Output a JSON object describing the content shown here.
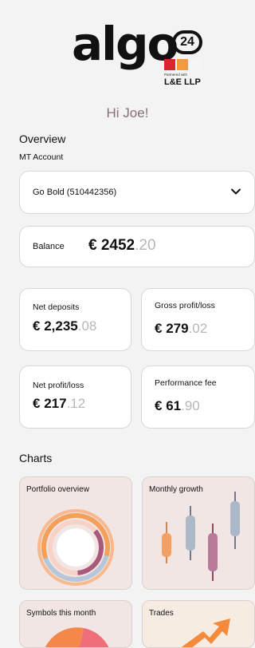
{
  "brand": {
    "wordmark": "algo",
    "badge": "24",
    "partner_small": "Partnered with",
    "partner_name": "L&E LLP",
    "colors": {
      "red": "#d9262b",
      "orange": "#f59a3c",
      "light": "#f5f5f5"
    }
  },
  "greeting": "Hi Joe!",
  "overview": {
    "title": "Overview",
    "account_label": "MT Account",
    "account_selected": "Go Bold (510442356)",
    "balance": {
      "label": "Balance",
      "currency": "€",
      "int": "2452",
      "dec": ".20"
    }
  },
  "stats": [
    {
      "label": "Net deposits",
      "currency": "€",
      "int": "2,235",
      "dec": ".08"
    },
    {
      "label": "Gross profit/loss",
      "currency": "€",
      "int": "279",
      "dec": ".02"
    },
    {
      "label": "Net profit/loss",
      "currency": "€",
      "int": "217",
      "dec": ".12"
    },
    {
      "label": "Performance fee",
      "currency": "€",
      "int": "61",
      "dec": ".90"
    }
  ],
  "charts": {
    "title": "Charts",
    "tiles": [
      {
        "label": "Portfolio overview",
        "icon": "donut-chart-icon"
      },
      {
        "label": "Monthly growth",
        "icon": "candlestick-icon"
      },
      {
        "label": "Symbols this month",
        "icon": "pie-chart-icon"
      },
      {
        "label": "Trades",
        "icon": "trend-arrow-icon"
      }
    ]
  }
}
